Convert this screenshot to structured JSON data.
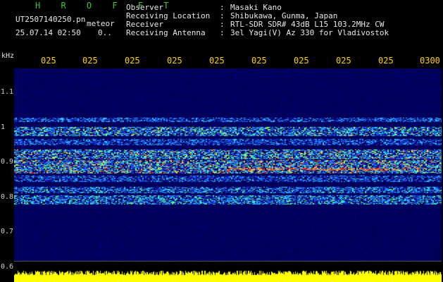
{
  "header": {
    "brand": "H R O F F T",
    "filename": "UT2507140250.pn",
    "type_label": "meteor",
    "datetime": "25.07.14 02:50",
    "count": "0.."
  },
  "info": [
    {
      "label": "Observer",
      "value": "Masaki Kano"
    },
    {
      "label": "Receiving Location",
      "value": "Shibukawa, Gunma, Japan"
    },
    {
      "label": "Receiver",
      "value": "RTL-SDR SDR# 43dB L15 103.2MHz CW"
    },
    {
      "label": "Receiving Antenna",
      "value": "3el Yagi(V) Az 330 for Vladivostok"
    }
  ],
  "separator": ":",
  "axis": {
    "y_unit": "kHz",
    "x_ticks": [
      "025",
      "025",
      "025",
      "025",
      "025",
      "025",
      "025",
      "025",
      "025",
      "0300"
    ],
    "y_ticks": [
      "1.1",
      "1",
      "0.9",
      "0.8",
      "0.7",
      "0.6"
    ]
  },
  "colors": {
    "background": "#000000",
    "brand": "#3ec43e",
    "time_labels": "#ffd200",
    "level_bar": "#ffff00"
  }
}
